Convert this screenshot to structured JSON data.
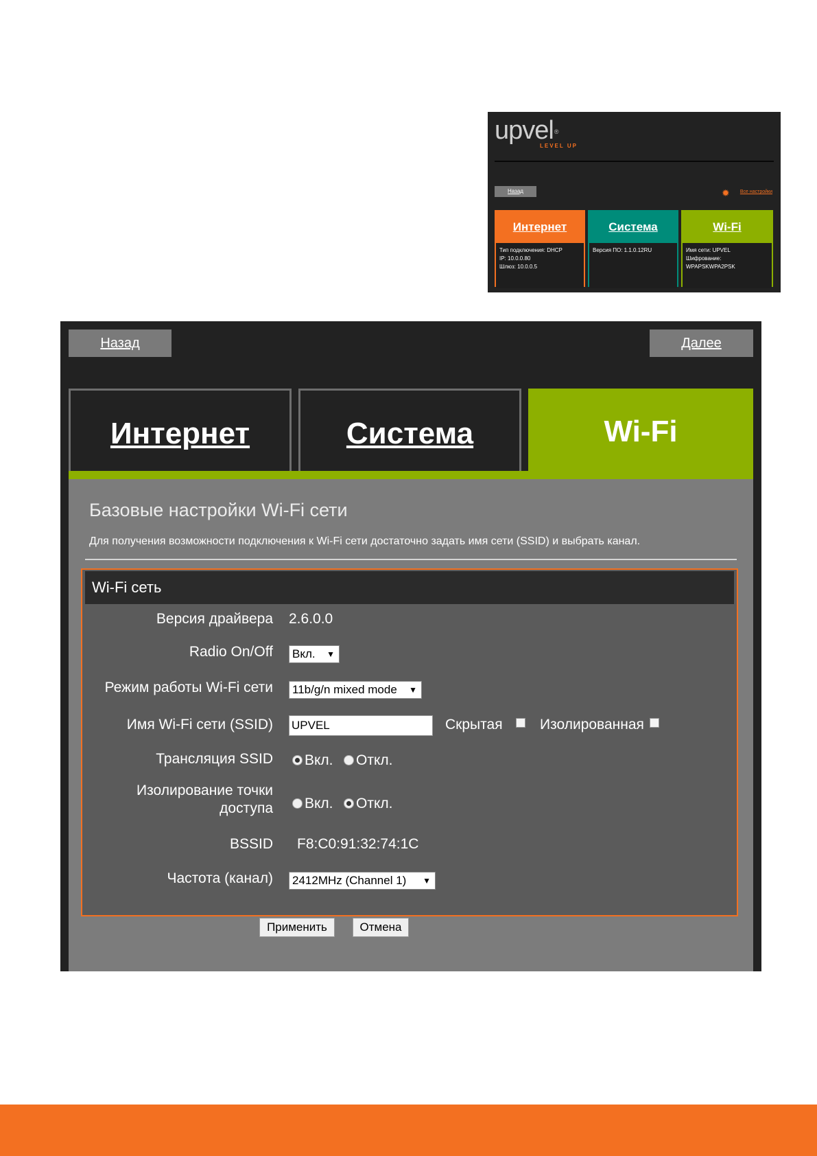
{
  "thumbnail": {
    "logo": "upvel",
    "logo_mark": "®",
    "tagline": "LEVEL UP",
    "back_label": "Назад",
    "all_settings_label": "Все настройки",
    "cards": [
      {
        "title": "Интернет",
        "lines": [
          "Тип подключения: DHCP",
          "IP: 10.0.0.80",
          "Шлюз: 10.0.0.5"
        ]
      },
      {
        "title": "Система",
        "lines": [
          "Версия ПО: 1.1.0.12RU"
        ]
      },
      {
        "title": "Wi-Fi",
        "lines": [
          "Имя сети: UPVEL",
          "Шифрование:",
          "WPAPSKWPA2PSK"
        ]
      }
    ]
  },
  "nav": {
    "back_label": "Назад",
    "next_label": "Далее"
  },
  "tabs": [
    {
      "label": "Интернет",
      "active": false
    },
    {
      "label": "Система",
      "active": false
    },
    {
      "label": "Wi-Fi",
      "active": true
    }
  ],
  "page": {
    "title": "Базовые настройки Wi-Fi сети",
    "description": "Для получения возможности подключения к Wi-Fi сети достаточно задать имя сети (SSID) и выбрать канал."
  },
  "section": {
    "title": "Wi-Fi сеть",
    "driver_version_label": "Версия драйвера",
    "driver_version_value": "2.6.0.0",
    "radio_label": "Radio On/Off",
    "radio_value": "Вкл.",
    "mode_label": "Режим работы Wi-Fi сети",
    "mode_value": "11b/g/n mixed mode",
    "ssid_label": "Имя Wi-Fi сети (SSID)",
    "ssid_value": "UPVEL",
    "hidden_label": "Скрытая",
    "isolated_label": "Изолированная",
    "broadcast_label": "Трансляция SSID",
    "broadcast_on": "Вкл.",
    "broadcast_off": "Откл.",
    "ap_isolation_label_1": "Изолирование точки",
    "ap_isolation_label_2": "доступа",
    "ap_isolation_on": "Вкл.",
    "ap_isolation_off": "Откл.",
    "bssid_label": "BSSID",
    "bssid_value": "F8:C0:91:32:74:1C",
    "channel_label": "Частота (канал)",
    "channel_value": "2412MHz (Channel 1)"
  },
  "actions": {
    "apply_label": "Применить",
    "cancel_label": "Отмена"
  },
  "colors": {
    "accent_orange": "#f37021",
    "accent_green": "#8db000",
    "accent_teal": "#008c7a",
    "panel_dark": "#222222",
    "content_grey": "#7c7c7c"
  }
}
